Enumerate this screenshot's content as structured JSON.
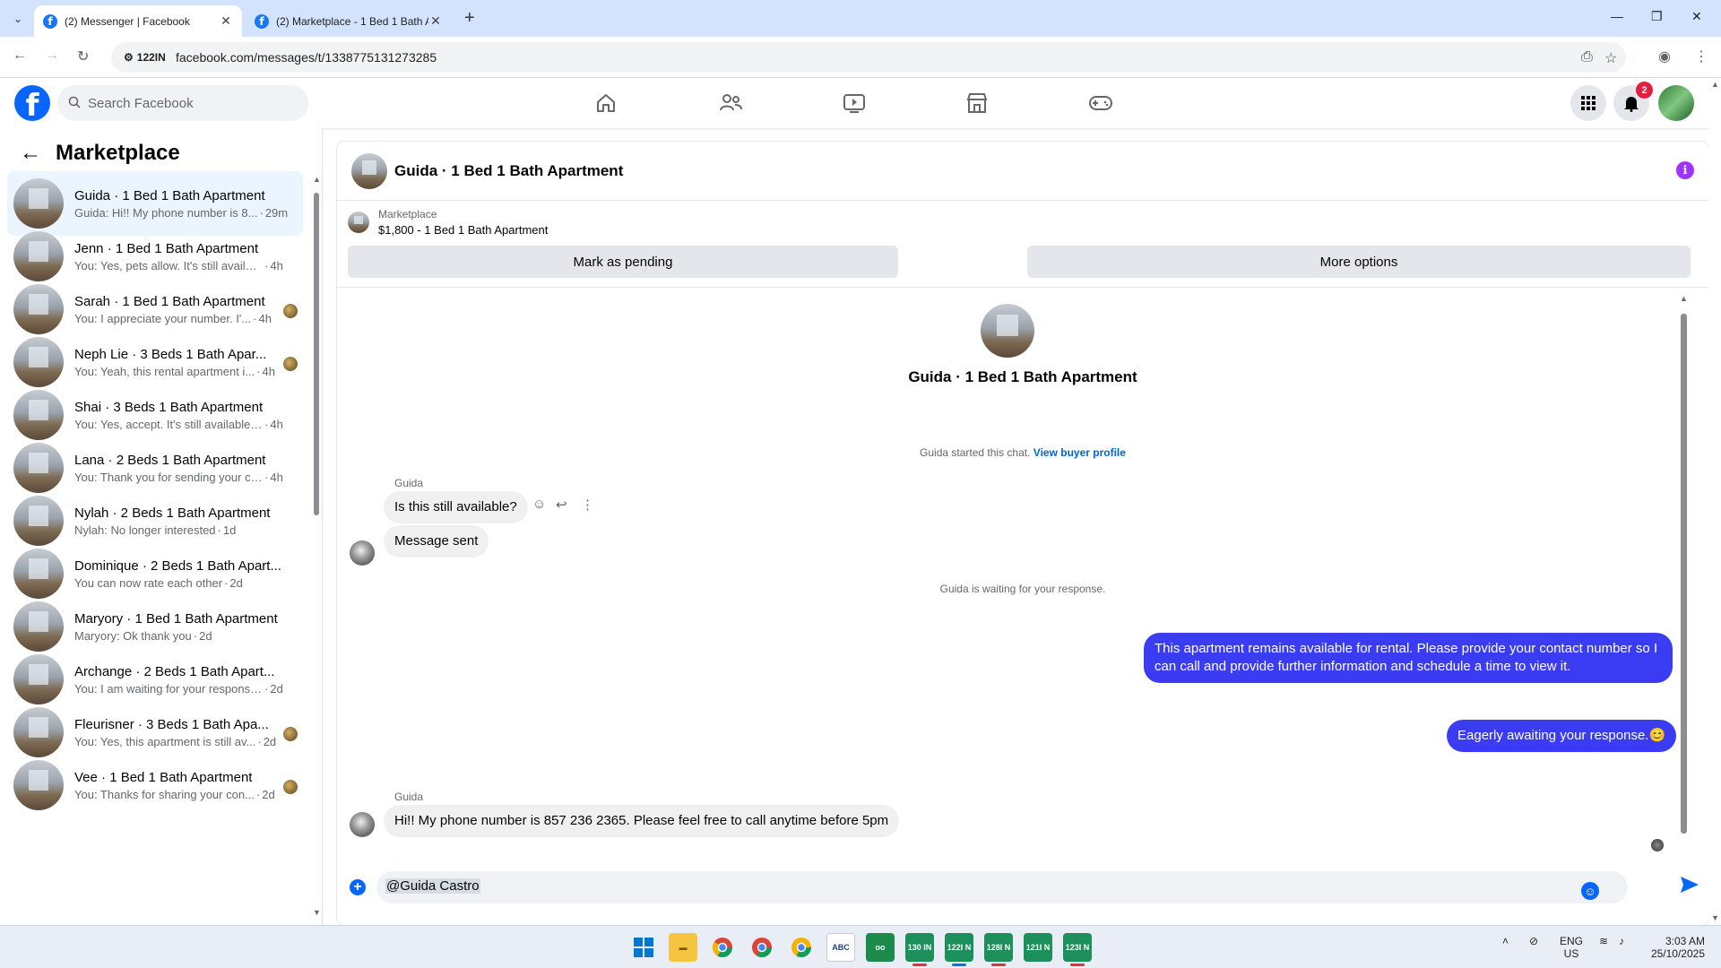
{
  "browser": {
    "tabs": [
      {
        "title": "(2) Messenger | Facebook",
        "active": true
      },
      {
        "title": "(2) Marketplace - 1 Bed 1 Bath A",
        "active": false
      }
    ],
    "site_badge": "122IN",
    "url": "facebook.com/messages/t/1338775131273285"
  },
  "fb": {
    "search_placeholder": "Search Facebook",
    "notification_count": "2",
    "nav_icons": [
      "home-icon",
      "friends-icon",
      "video-icon",
      "marketplace-icon",
      "gaming-icon"
    ]
  },
  "sidebar": {
    "title": "Marketplace",
    "conversations": [
      {
        "name": "Guida · 1 Bed 1 Bath Apartment",
        "snippet": "Guida: Hi!! My phone number is 8...",
        "time": "29m",
        "selected": true
      },
      {
        "name": "Jenn · 1 Bed 1 Bath Apartment",
        "snippet": "You: Yes, pets allow. It's still availabl...",
        "time": "4h"
      },
      {
        "name": "Sarah · 1 Bed 1 Bath Apartment",
        "snippet": "You: I appreciate your number. I'...",
        "time": "4h"
      },
      {
        "name": "Neph Lie · 3 Beds 1 Bath Apar...",
        "snippet": "You: Yeah, this rental apartment i...",
        "time": "4h"
      },
      {
        "name": "Shai · 3 Beds 1 Bath Apartment",
        "snippet": "You: Yes, accept. It's still available. If...",
        "time": "4h"
      },
      {
        "name": "Lana · 2 Beds 1 Bath Apartment",
        "snippet": "You: Thank you for sending your co...",
        "time": "4h"
      },
      {
        "name": "Nylah · 2 Beds 1 Bath Apartment",
        "snippet": "Nylah: No longer interested",
        "time": "1d"
      },
      {
        "name": "Dominique · 2 Beds 1 Bath Apart...",
        "snippet": "You can now rate each other",
        "time": "2d"
      },
      {
        "name": "Maryory · 1 Bed 1 Bath Apartment",
        "snippet": "Maryory: Ok thank you",
        "time": "2d"
      },
      {
        "name": "Archange · 2 Beds 1 Bath Apart...",
        "snippet": "You: I am waiting for your response...",
        "time": "2d"
      },
      {
        "name": "Fleurisner · 3 Beds 1 Bath Apa...",
        "snippet": "You: Yes, this apartment is still av...",
        "time": "2d"
      },
      {
        "name": "Vee · 1 Bed 1 Bath Apartment",
        "snippet": "You: Thanks for sharing your con...",
        "time": "2d"
      }
    ]
  },
  "chat": {
    "title": "Guida · 1 Bed 1 Bath Apartment",
    "listing_category": "Marketplace",
    "listing_price": "$1,800 - 1 Bed 1 Bath Apartment",
    "mark_pending": "Mark as pending",
    "more_options": "More options",
    "center_title": "Guida · 1 Bed 1 Bath Apartment",
    "started_text": "Guida started this chat.",
    "view_buyer": "View buyer profile",
    "sender1": "Guida",
    "msg1": "Is this still available?",
    "msg2": "Message sent",
    "waiting": "Guida is waiting for your response.",
    "out1_line1": "This apartment remains available for rental. Please provide your contact number so I",
    "out1_line2": "can call and provide further information and schedule a time to view it.",
    "out2": "Eagerly awaiting your response.😊",
    "sender2": "Guida",
    "msg3": "Hi!! My phone number is 857 236 2365. Please feel free to call anytime before 5pm",
    "composer_text": "@Guida Castro"
  },
  "taskbar": {
    "apps": [
      "130 IN",
      "122I N",
      "128I N",
      "121I N",
      "123I N"
    ],
    "lang_1": "ENG",
    "lang_2": "US",
    "time": "3:03 AM",
    "date": "25/10/2025"
  },
  "colors": {
    "fb_blue": "#0866ff",
    "outgoing_bubble": "#3b3bf5",
    "selected_conv": "#ebf5ff",
    "info_purple": "#a033ff",
    "badge_red": "#e41e3f"
  }
}
